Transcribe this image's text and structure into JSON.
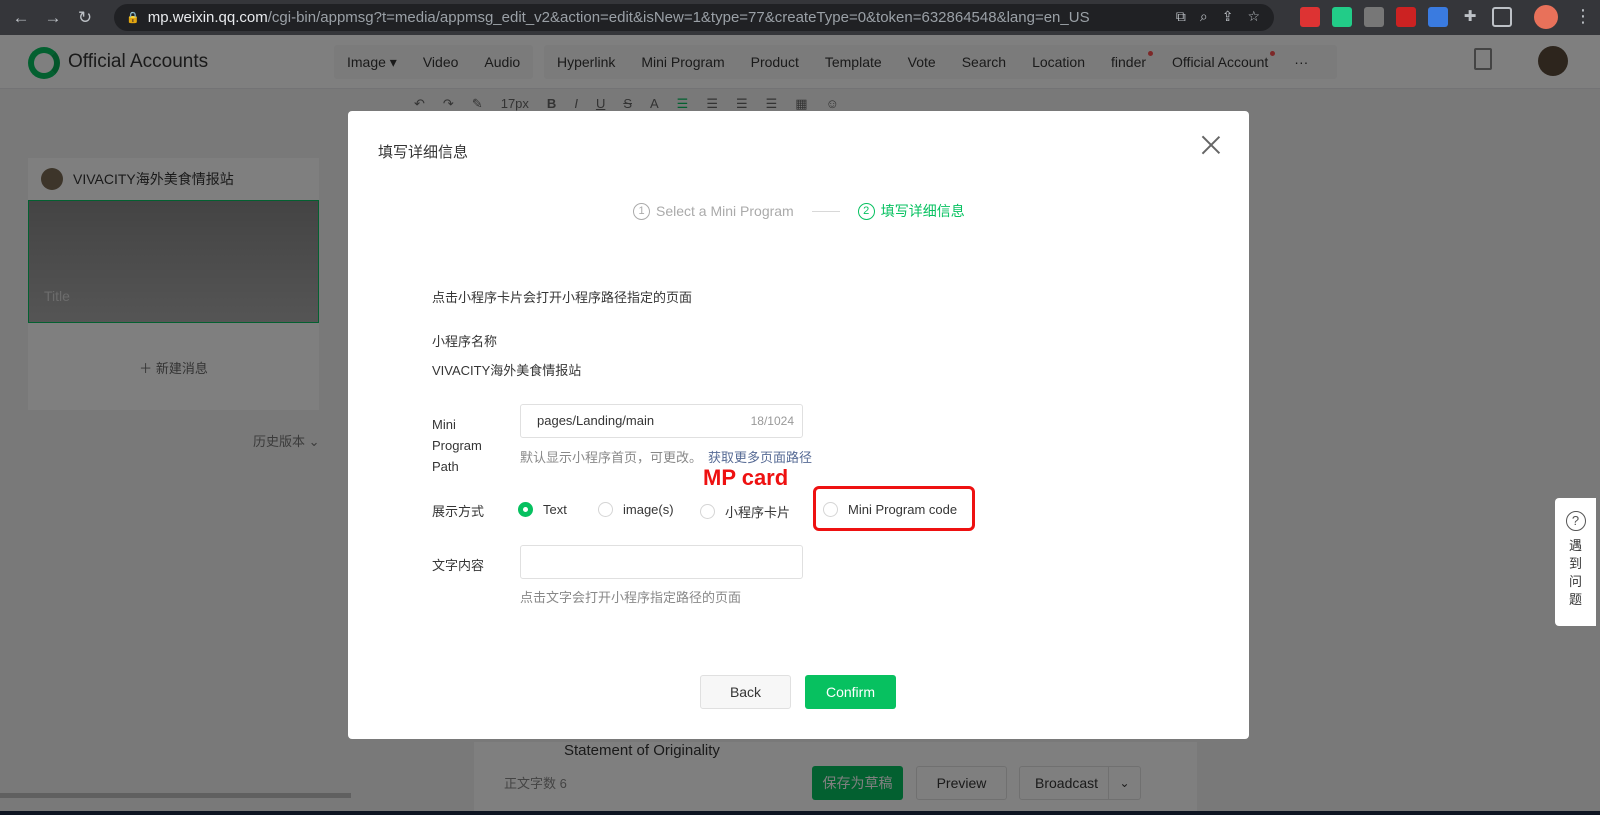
{
  "browser": {
    "url_host": "mp.weixin.qq.com",
    "url_path": "/cgi-bin/appmsg?t=media/appmsg_edit_v2&action=edit&isNew=1&type=77&createType=0&token=632864548&lang=en_US"
  },
  "header": {
    "brand": "Official Accounts",
    "toolbar_left": [
      "Image",
      "Video",
      "Audio"
    ],
    "toolbar_right": [
      "Hyperlink",
      "Mini Program",
      "Product",
      "Template",
      "Vote",
      "Search",
      "Location",
      "finder",
      "Official Account"
    ],
    "more": "···"
  },
  "format_bar": {
    "font_size": "17px"
  },
  "left_panel": {
    "account_name": "VIVACITY海外美食情报站",
    "cover_title": "Title",
    "new_message": "新建消息",
    "history": "历史版本"
  },
  "bottom": {
    "originality": "Statement of Originality",
    "word_count_label": "正文字数",
    "word_count": "6",
    "save_draft": "保存为草稿",
    "preview": "Preview",
    "broadcast": "Broadcast"
  },
  "help": {
    "icon": "?",
    "text": "遇到问题"
  },
  "dialog": {
    "title": "填写详细信息",
    "steps": [
      {
        "num": "1",
        "label": "Select a Mini Program"
      },
      {
        "num": "2",
        "label": "填写详细信息"
      }
    ],
    "description": "点击小程序卡片会打开小程序路径指定的页面",
    "mp_name_label": "小程序名称",
    "mp_name_value": "VIVACITY海外美食情报站",
    "path_label": "Mini Program Path",
    "path_value": "pages/Landing/main",
    "path_count": "18/1024",
    "path_hint": "默认显示小程序首页，可更改。",
    "path_link": "获取更多页面路径",
    "display_label": "展示方式",
    "display_options": [
      "Text",
      "image(s)",
      "小程序卡片",
      "Mini Program code"
    ],
    "display_selected": "Text",
    "annotation": "MP card",
    "text_label": "文字内容",
    "text_value": "",
    "text_hint": "点击文字会打开小程序指定路径的页面",
    "back": "Back",
    "confirm": "Confirm"
  },
  "colors": {
    "accent": "#07c160",
    "link": "#576b95",
    "annotation": "#ee1111"
  }
}
